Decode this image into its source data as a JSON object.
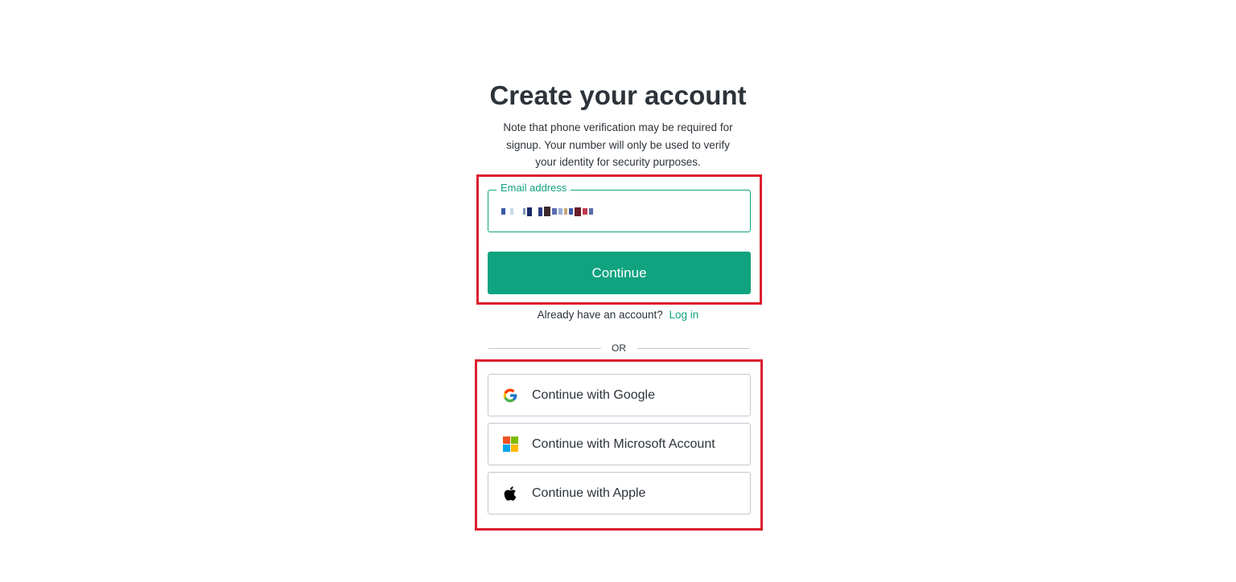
{
  "header": {
    "title": "Create your account",
    "note_line1": "Note that phone verification may be required for",
    "note_line2": "signup. Your number will only be used to verify",
    "note_line3": "your identity for security purposes."
  },
  "form": {
    "email_label": "Email address",
    "email_value": "[redacted]",
    "continue_label": "Continue"
  },
  "login": {
    "prompt": "Already have an account?",
    "link": "Log in"
  },
  "divider": {
    "text": "OR"
  },
  "social": {
    "google": {
      "label": "Continue with Google",
      "icon": "google-icon"
    },
    "microsoft": {
      "label": "Continue with Microsoft Account",
      "icon": "microsoft-icon"
    },
    "apple": {
      "label": "Continue with Apple",
      "icon": "apple-icon"
    }
  },
  "colors": {
    "accent": "#10a37f",
    "highlight": "#dc1f2e",
    "text": "#2d333a",
    "border": "#c2c8d0"
  }
}
